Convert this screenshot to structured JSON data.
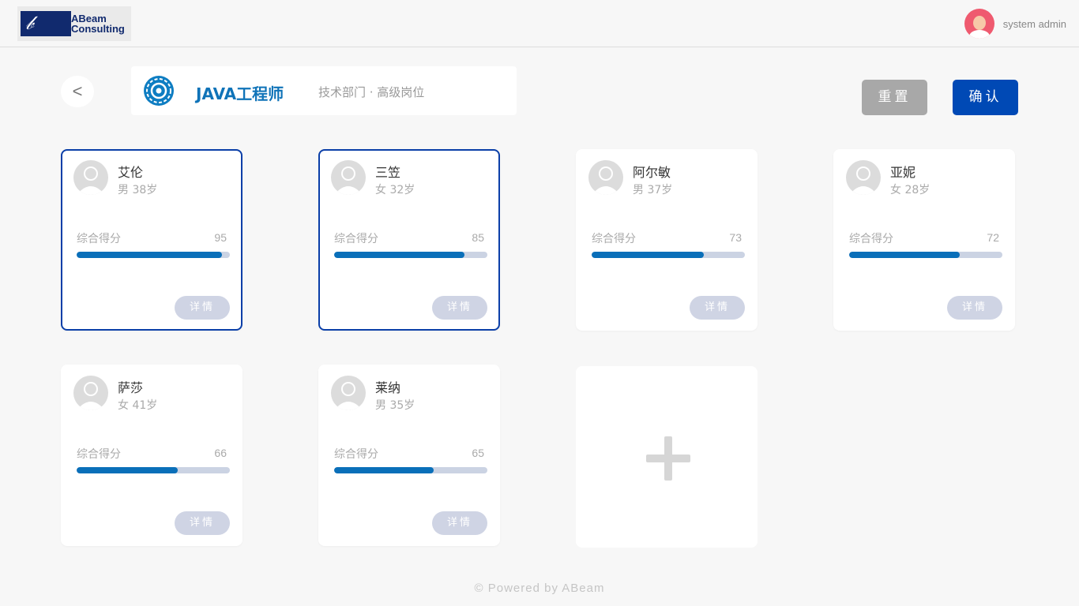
{
  "header": {
    "logo_text_line1": "ABeam",
    "logo_text_line2": "Consulting",
    "user_name": "system admin"
  },
  "job": {
    "back_label": "<",
    "title": "JAVA工程师",
    "subtitle": "技术部门 · 高级岗位"
  },
  "actions": {
    "reset_label": "重置",
    "confirm_label": "确认"
  },
  "score_label": "综合得分",
  "detail_label": "详情",
  "candidates": [
    {
      "name": "艾伦",
      "meta": "男 38岁",
      "score": "95",
      "selected": true
    },
    {
      "name": "三笠",
      "meta": "女 32岁",
      "score": "85",
      "selected": true
    },
    {
      "name": "阿尔敏",
      "meta": "男 37岁",
      "score": "73",
      "selected": false
    },
    {
      "name": "亚妮",
      "meta": "女 28岁",
      "score": "72",
      "selected": false
    },
    {
      "name": "萨莎",
      "meta": "女 41岁",
      "score": "66",
      "selected": false
    },
    {
      "name": "莱纳",
      "meta": "男 35岁",
      "score": "65",
      "selected": false
    }
  ],
  "footer": "© Powered by ABeam",
  "colors": {
    "accent": "#0049b5",
    "progress": "#0a6fb9",
    "selected_border": "#0b3fa8",
    "reset": "#a8a8a8"
  }
}
